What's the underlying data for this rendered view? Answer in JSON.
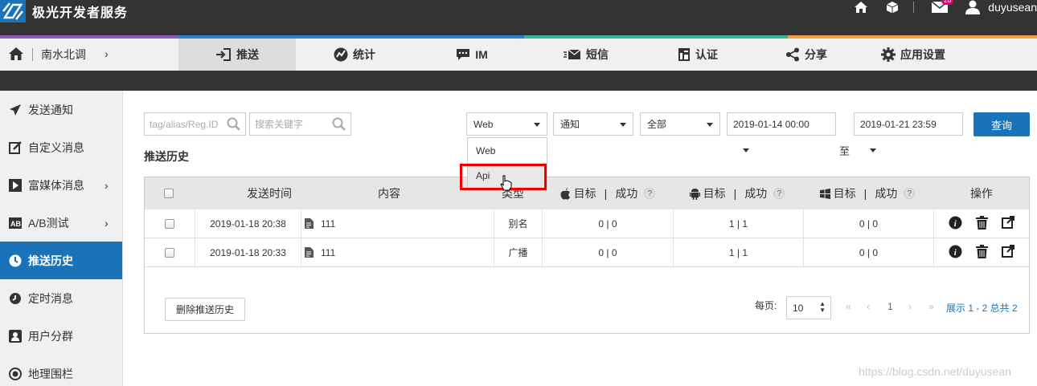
{
  "header": {
    "brand": "极光开发者服务",
    "username": "duyusean",
    "mail_badge": "20"
  },
  "nav": {
    "breadcrumb": "南水北调",
    "tabs": [
      {
        "label": "推送",
        "icon": "sign-in-icon",
        "active": true
      },
      {
        "label": "统计",
        "icon": "chart-icon"
      },
      {
        "label": "IM",
        "icon": "chat-icon"
      },
      {
        "label": "短信",
        "icon": "envelope-send-icon"
      },
      {
        "label": "认证",
        "icon": "id-card-icon"
      },
      {
        "label": "分享",
        "icon": "share-icon"
      },
      {
        "label": "应用设置",
        "icon": "gear-icon"
      }
    ]
  },
  "sidebar": {
    "items": [
      {
        "label": "发送通知",
        "icon": "paper-plane-icon"
      },
      {
        "label": "自定义消息",
        "icon": "edit-icon"
      },
      {
        "label": "富媒体消息",
        "icon": "play-icon",
        "has_submenu": true
      },
      {
        "label": "A/B测试",
        "icon": "ab-icon",
        "has_submenu": true
      },
      {
        "label": "推送历史",
        "icon": "clock-icon",
        "active": true
      },
      {
        "label": "定时消息",
        "icon": "timer-icon"
      },
      {
        "label": "用户分群",
        "icon": "user-card-icon"
      },
      {
        "label": "地理围栏",
        "icon": "target-icon"
      }
    ]
  },
  "filters": {
    "tag_placeholder": "tag/alias/Reg.ID",
    "keyword_placeholder": "搜索关键字",
    "platform_value": "Web",
    "platform_options": [
      "Web",
      "Api"
    ],
    "type_value": "通知",
    "scope_value": "全部",
    "start_date": "2019-01-14 00:00",
    "end_date": "2019-01-21 23:59",
    "to_label": "至",
    "query_label": "查询"
  },
  "section_title": "推送历史",
  "table": {
    "headers": {
      "time": "发送时间",
      "content": "内容",
      "type": "类型",
      "ios_target": "目标",
      "ios_success": "成功",
      "android_target": "目标",
      "android_success": "成功",
      "win_target": "目标",
      "win_success": "成功",
      "sep": "|",
      "help": "?",
      "actions": "操作"
    },
    "rows": [
      {
        "time": "2019-01-18 20:38",
        "content": "111",
        "type": "别名",
        "ios": "0 | 0",
        "android": "1 | 1",
        "win": "0 | 0"
      },
      {
        "time": "2019-01-18 20:33",
        "content": "111",
        "type": "广播",
        "ios": "0 | 0",
        "android": "1 | 1",
        "win": "0 | 0"
      }
    ]
  },
  "footer": {
    "delete_label": "删除推送历史",
    "page_size_label": "每页:",
    "page_size": "10",
    "current_page": "1",
    "summary": "展示 1 - 2 总共 2",
    "first": "«",
    "prev": "‹",
    "next": "›",
    "last": "»"
  },
  "watermark": "https://blog.csdn.net/duyusean",
  "colors": {
    "topbar": "#333333",
    "accent": "#1a73b8",
    "highlight_box": "#ee0000"
  }
}
